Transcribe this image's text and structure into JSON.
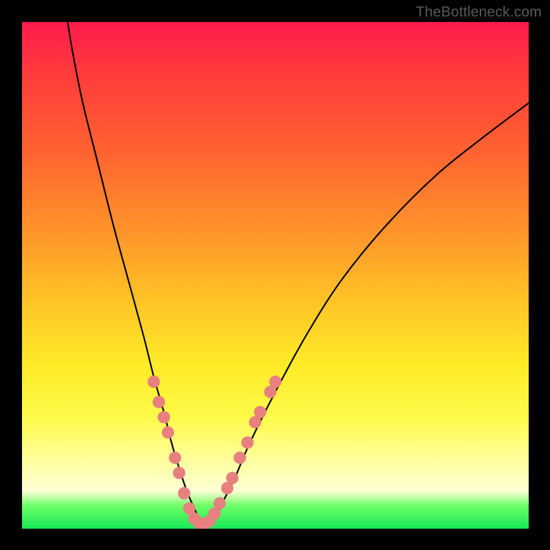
{
  "watermark": "TheBottleneck.com",
  "chart_data": {
    "type": "line",
    "title": "",
    "xlabel": "",
    "ylabel": "",
    "xlim": [
      0,
      100
    ],
    "ylim": [
      0,
      100
    ],
    "series": [
      {
        "name": "bottleneck-curve",
        "x": [
          9,
          10,
          12,
          15,
          18,
          21,
          24,
          26,
          28,
          29.5,
          31,
          32.5,
          34,
          35,
          36,
          37,
          38.5,
          40,
          42,
          45,
          50,
          56,
          63,
          72,
          82,
          92,
          100
        ],
        "y": [
          100,
          94,
          84,
          72,
          60,
          49,
          38,
          30,
          23,
          17,
          12,
          7.5,
          4,
          2,
          1,
          1.5,
          3,
          6,
          10,
          17,
          27,
          38,
          49,
          60,
          70,
          78,
          84
        ]
      }
    ],
    "markers": {
      "name": "curve-dots",
      "color": "#E98080",
      "points": [
        {
          "x": 26.0,
          "y": 29
        },
        {
          "x": 27.0,
          "y": 25
        },
        {
          "x": 28.0,
          "y": 22
        },
        {
          "x": 28.8,
          "y": 19
        },
        {
          "x": 30.2,
          "y": 14
        },
        {
          "x": 31.0,
          "y": 11
        },
        {
          "x": 32.0,
          "y": 7
        },
        {
          "x": 33.0,
          "y": 4
        },
        {
          "x": 34.0,
          "y": 2
        },
        {
          "x": 35.0,
          "y": 1
        },
        {
          "x": 36.0,
          "y": 1
        },
        {
          "x": 37.0,
          "y": 1.5
        },
        {
          "x": 38.0,
          "y": 3
        },
        {
          "x": 39.0,
          "y": 5
        },
        {
          "x": 40.5,
          "y": 8
        },
        {
          "x": 41.5,
          "y": 10
        },
        {
          "x": 43.0,
          "y": 14
        },
        {
          "x": 44.5,
          "y": 17
        },
        {
          "x": 46.0,
          "y": 21
        },
        {
          "x": 47.0,
          "y": 23
        },
        {
          "x": 49.0,
          "y": 27
        },
        {
          "x": 50.0,
          "y": 29
        }
      ]
    }
  }
}
